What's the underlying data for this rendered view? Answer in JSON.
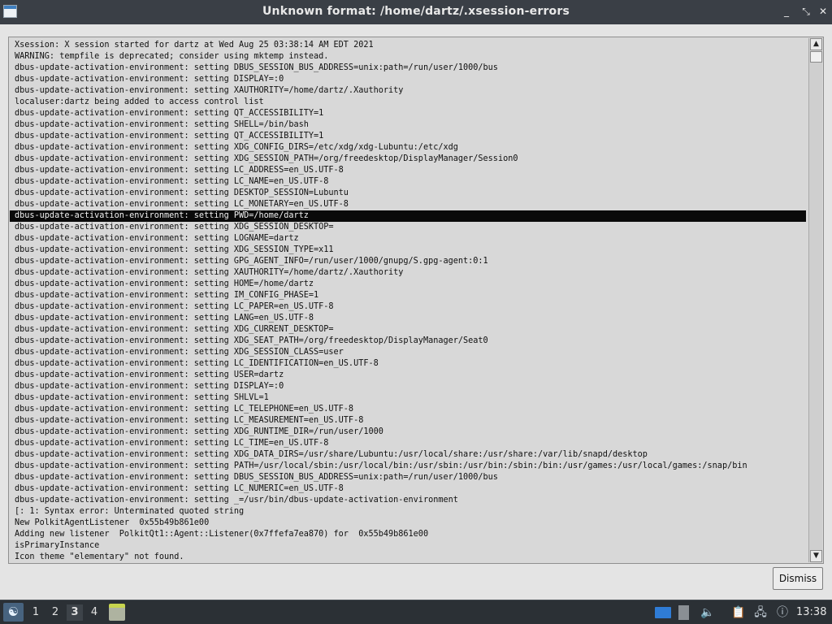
{
  "window": {
    "title": "Unknown format: /home/dartz/.xsession-errors",
    "minimize_glyph": "_",
    "maximize_glyph": "⤡",
    "close_glyph": "✕"
  },
  "log_lines": [
    "Xsession: X session started for dartz at Wed Aug 25 03:38:14 AM EDT 2021",
    "WARNING: tempfile is deprecated; consider using mktemp instead.",
    "dbus-update-activation-environment: setting DBUS_SESSION_BUS_ADDRESS=unix:path=/run/user/1000/bus",
    "dbus-update-activation-environment: setting DISPLAY=:0",
    "dbus-update-activation-environment: setting XAUTHORITY=/home/dartz/.Xauthority",
    "localuser:dartz being added to access control list",
    "dbus-update-activation-environment: setting QT_ACCESSIBILITY=1",
    "dbus-update-activation-environment: setting SHELL=/bin/bash",
    "dbus-update-activation-environment: setting QT_ACCESSIBILITY=1",
    "dbus-update-activation-environment: setting XDG_CONFIG_DIRS=/etc/xdg/xdg-Lubuntu:/etc/xdg",
    "dbus-update-activation-environment: setting XDG_SESSION_PATH=/org/freedesktop/DisplayManager/Session0",
    "dbus-update-activation-environment: setting LC_ADDRESS=en_US.UTF-8",
    "dbus-update-activation-environment: setting LC_NAME=en_US.UTF-8",
    "dbus-update-activation-environment: setting DESKTOP_SESSION=Lubuntu",
    "dbus-update-activation-environment: setting LC_MONETARY=en_US.UTF-8",
    "dbus-update-activation-environment: setting PWD=/home/dartz",
    "dbus-update-activation-environment: setting XDG_SESSION_DESKTOP=",
    "dbus-update-activation-environment: setting LOGNAME=dartz",
    "dbus-update-activation-environment: setting XDG_SESSION_TYPE=x11",
    "dbus-update-activation-environment: setting GPG_AGENT_INFO=/run/user/1000/gnupg/S.gpg-agent:0:1",
    "dbus-update-activation-environment: setting XAUTHORITY=/home/dartz/.Xauthority",
    "dbus-update-activation-environment: setting HOME=/home/dartz",
    "dbus-update-activation-environment: setting IM_CONFIG_PHASE=1",
    "dbus-update-activation-environment: setting LC_PAPER=en_US.UTF-8",
    "dbus-update-activation-environment: setting LANG=en_US.UTF-8",
    "dbus-update-activation-environment: setting XDG_CURRENT_DESKTOP=",
    "dbus-update-activation-environment: setting XDG_SEAT_PATH=/org/freedesktop/DisplayManager/Seat0",
    "dbus-update-activation-environment: setting XDG_SESSION_CLASS=user",
    "dbus-update-activation-environment: setting LC_IDENTIFICATION=en_US.UTF-8",
    "dbus-update-activation-environment: setting USER=dartz",
    "dbus-update-activation-environment: setting DISPLAY=:0",
    "dbus-update-activation-environment: setting SHLVL=1",
    "dbus-update-activation-environment: setting LC_TELEPHONE=en_US.UTF-8",
    "dbus-update-activation-environment: setting LC_MEASUREMENT=en_US.UTF-8",
    "dbus-update-activation-environment: setting XDG_RUNTIME_DIR=/run/user/1000",
    "dbus-update-activation-environment: setting LC_TIME=en_US.UTF-8",
    "dbus-update-activation-environment: setting XDG_DATA_DIRS=/usr/share/Lubuntu:/usr/local/share:/usr/share:/var/lib/snapd/desktop",
    "dbus-update-activation-environment: setting PATH=/usr/local/sbin:/usr/local/bin:/usr/sbin:/usr/bin:/sbin:/bin:/usr/games:/usr/local/games:/snap/bin",
    "dbus-update-activation-environment: setting DBUS_SESSION_BUS_ADDRESS=unix:path=/run/user/1000/bus",
    "dbus-update-activation-environment: setting LC_NUMERIC=en_US.UTF-8",
    "dbus-update-activation-environment: setting _=/usr/bin/dbus-update-activation-environment",
    "[: 1: Syntax error: Unterminated quoted string",
    "New PolkitAgentListener  0x55b49b861e00",
    "Adding new listener  PolkitQt1::Agent::Listener(0x7ffefa7ea870) for  0x55b49b861e00",
    "isPrimaryInstance",
    "Icon theme \"elementary\" not found."
  ],
  "selected_line_index": 15,
  "buttons": {
    "dismiss_label": "Dismiss"
  },
  "scrollbar": {
    "up_glyph": "▲",
    "down_glyph": "▼"
  },
  "taskbar": {
    "workspaces": [
      "1",
      "2",
      "3",
      "4"
    ],
    "active_workspace": 3,
    "clock": "13:38",
    "menu_glyph": "☯",
    "volume_glyph": "🔈",
    "clipboard_glyph": "📋",
    "network_glyph": "🖧",
    "updates_glyph": "ⓘ"
  },
  "colors": {
    "titlebar_bg": "#3a3f46",
    "selection_bg": "#0a0a0a",
    "taskbar_bg": "#2b3035",
    "menu_accent": "#47637f"
  }
}
